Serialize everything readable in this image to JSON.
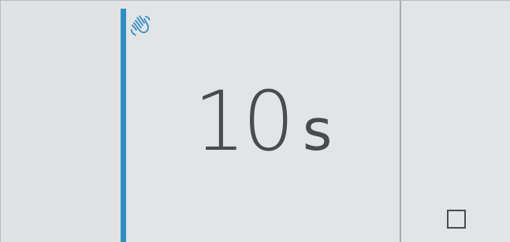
{
  "timer": {
    "value": "10",
    "unit": "s"
  },
  "icons": {
    "status": "hand-wave-icon",
    "control": "stop-square-icon"
  },
  "colors": {
    "accent": "#2f8ec4",
    "text": "#4a4b4d",
    "background": "#e2e3e5"
  }
}
